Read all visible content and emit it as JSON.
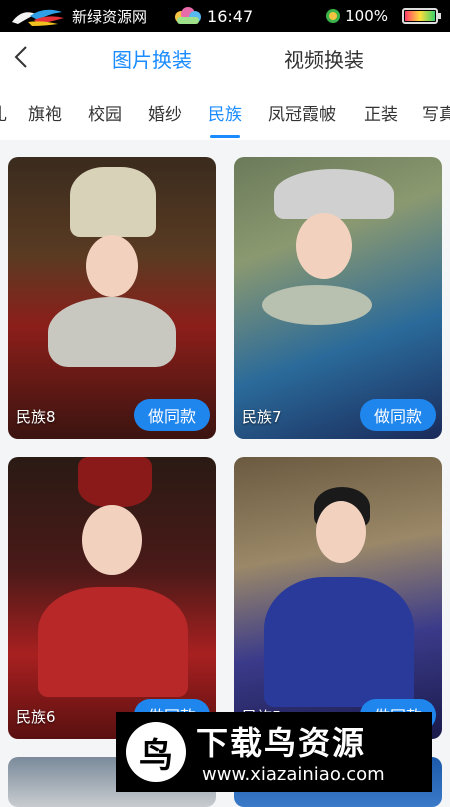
{
  "status_bar": {
    "brand": "新绿资源网",
    "time": "16:47",
    "battery_pct": "100%",
    "battery_level": 1.0
  },
  "header": {
    "tabs": [
      {
        "label": "图片换装",
        "active": true
      },
      {
        "label": "视频换装",
        "active": false
      }
    ]
  },
  "categories": [
    {
      "label": "旗袍",
      "active": false
    },
    {
      "label": "校园",
      "active": false
    },
    {
      "label": "婚纱",
      "active": false
    },
    {
      "label": "民族",
      "active": true
    },
    {
      "label": "凤冠霞帔",
      "active": false
    },
    {
      "label": "正装",
      "active": false
    },
    {
      "label": "写真",
      "active": false
    }
  ],
  "cards": [
    {
      "label": "民族8",
      "button": "做同款"
    },
    {
      "label": "民族7",
      "button": "做同款"
    },
    {
      "label": "民族6",
      "button": "做同款"
    },
    {
      "label": "民族5",
      "button": "做同款"
    }
  ],
  "watermark": {
    "title": "下载鸟资源",
    "url": "www.xiazainiao.com",
    "icon_char": "鸟"
  },
  "colors": {
    "accent": "#1a8cff",
    "button": "#1f86ee"
  }
}
